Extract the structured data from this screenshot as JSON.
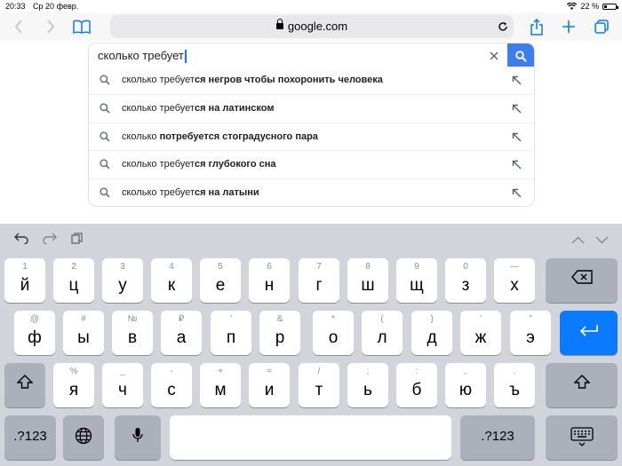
{
  "status_bar": {
    "time": "20:33",
    "date": "Ср 20 февр.",
    "battery": "22 %",
    "battery_level": 0.22
  },
  "browser": {
    "url": "google.com",
    "icons": {
      "back": "chevron-left-icon",
      "forward": "chevron-right-icon",
      "bookmarks": "book-icon",
      "lock": "lock-icon",
      "reload": "reload-icon",
      "share": "share-icon",
      "new_tab": "plus-icon",
      "tabs": "tabs-icon"
    }
  },
  "search": {
    "query": "сколько требует"
  },
  "suggestions": [
    {
      "normal": "сколько требует",
      "bold": "ся негров чтобы похоронить человека"
    },
    {
      "normal": "сколько требует",
      "bold": "ся на латинском"
    },
    {
      "normal": "сколько ",
      "bold": "потребуется стоградусного пара"
    },
    {
      "normal": "сколько требует",
      "bold": "ся глубокого сна"
    },
    {
      "normal": "сколько требует",
      "bold": "ся на латыни"
    }
  ],
  "keyboard": {
    "row1": [
      {
        "sec": "1",
        "key": "й"
      },
      {
        "sec": "2",
        "key": "ц"
      },
      {
        "sec": "3",
        "key": "у"
      },
      {
        "sec": "4",
        "key": "к"
      },
      {
        "sec": "5",
        "key": "е"
      },
      {
        "sec": "6",
        "key": "н"
      },
      {
        "sec": "7",
        "key": "г"
      },
      {
        "sec": "8",
        "key": "ш"
      },
      {
        "sec": "9",
        "key": "щ"
      },
      {
        "sec": "0",
        "key": "з"
      },
      {
        "sec": "—",
        "key": "х"
      }
    ],
    "row2": [
      {
        "sec": "@",
        "key": "ф"
      },
      {
        "sec": "#",
        "key": "ы"
      },
      {
        "sec": "№",
        "key": "в"
      },
      {
        "sec": "₽",
        "key": "а"
      },
      {
        "sec": "’",
        "key": "п"
      },
      {
        "sec": "&",
        "key": "р"
      },
      {
        "sec": "*",
        "key": "о"
      },
      {
        "sec": "(",
        "key": "л"
      },
      {
        "sec": ")",
        "key": "д"
      },
      {
        "sec": "’",
        "key": "ж"
      },
      {
        "sec": "”",
        "key": "э"
      }
    ],
    "row3": [
      {
        "sec": "%",
        "key": "я"
      },
      {
        "sec": "_",
        "key": "ч"
      },
      {
        "sec": "-",
        "key": "с"
      },
      {
        "sec": "+",
        "key": "м"
      },
      {
        "sec": "=",
        "key": "и"
      },
      {
        "sec": "/",
        "key": "т"
      },
      {
        "sec": ";",
        "key": "ь"
      },
      {
        "sec": ":",
        "key": "б"
      },
      {
        "sec": ",",
        "key": "ю"
      },
      {
        "sec": ".",
        "key": "ъ"
      }
    ],
    "numbers_label": ".?123",
    "accent_color": "#0a7aff",
    "icons": {
      "undo": "undo-icon",
      "redo": "redo-icon",
      "paste": "paste-icon",
      "prev": "chevron-up-icon",
      "next": "chevron-down-icon",
      "delete": "delete-icon",
      "return": "return-icon",
      "shift": "shift-icon",
      "globe": "globe-icon",
      "mic": "microphone-icon",
      "dismiss": "keyboard-dismiss-icon"
    }
  }
}
